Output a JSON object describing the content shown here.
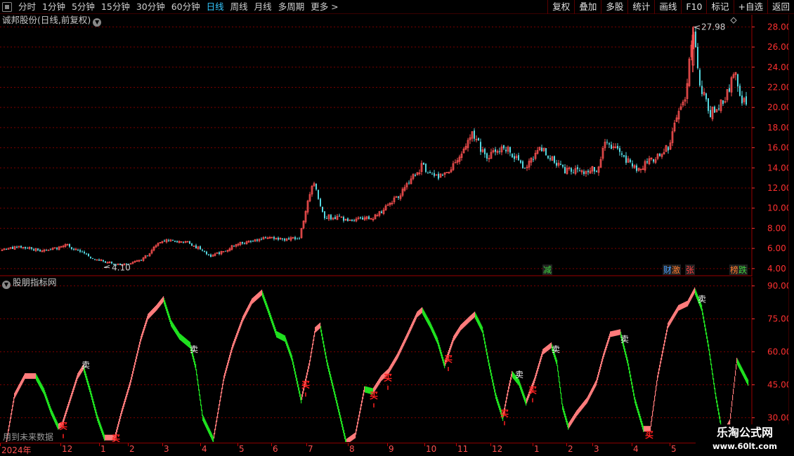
{
  "toolbar": {
    "periods": [
      "分时",
      "1分钟",
      "5分钟",
      "15分钟",
      "30分钟",
      "60分钟",
      "日线",
      "周线",
      "月线",
      "多周期",
      "更多"
    ],
    "active_period": "日线",
    "more_arrow": ">",
    "tools": [
      "复权",
      "叠加",
      "多股",
      "统计",
      "画线",
      "F10",
      "标记",
      "+自选",
      "返回"
    ]
  },
  "main_chart": {
    "title": "诚邦股份(日线,前复权)",
    "price_ticks": [
      "28.00",
      "26.00",
      "24.00",
      "22.00",
      "20.00",
      "18.00",
      "16.00",
      "14.00",
      "12.00",
      "10.00",
      "8.00",
      "6.00",
      "4.00"
    ],
    "high_label": "27.98",
    "low_label": "4.10",
    "markers": [
      {
        "text": "减",
        "color": "#3fd23f"
      },
      {
        "text": "财",
        "color": "#4aa0ff"
      },
      {
        "text": "激",
        "color": "#ff7b2e"
      },
      {
        "text": "张",
        "color": "#ff4040"
      },
      {
        "text": "榜",
        "color": "#ff7b2e"
      },
      {
        "text": "跌",
        "color": "#3fd23f"
      }
    ],
    "colors": {
      "up": "#ff5252",
      "down": "#54d8e0",
      "grid": "#7a0000"
    }
  },
  "sub_chart": {
    "title": "股朋指标网",
    "value_ticks": [
      "90.00",
      "75.00",
      "60.00",
      "45.00",
      "30.00"
    ],
    "sell_label": "卖",
    "buy_label": "买",
    "future_text": "用到未来数据",
    "colors": {
      "rising": "#ff7b7b",
      "falling": "#1fe01f"
    }
  },
  "date_axis": {
    "labels": [
      "2024年",
      "12",
      "1",
      "2",
      "3",
      "4",
      "5",
      "6",
      "7",
      "8",
      "9",
      "10",
      "11",
      "12",
      "1",
      "2",
      "3",
      "4",
      "5"
    ]
  },
  "watermark": {
    "title": "乐淘公式网",
    "url": "www.60lt.com"
  },
  "chart_data": [
    {
      "type": "candlestick",
      "title": "诚邦股份(日线,前复权)",
      "ylim": [
        3.5,
        29
      ],
      "y_ticks": [
        4,
        6,
        8,
        10,
        12,
        14,
        16,
        18,
        20,
        22,
        24,
        26,
        28
      ],
      "anchors_close": [
        [
          0,
          5.8
        ],
        [
          30,
          6.2
        ],
        [
          60,
          5.7
        ],
        [
          95,
          6.3
        ],
        [
          130,
          5.0
        ],
        [
          170,
          4.3
        ],
        [
          200,
          4.8
        ],
        [
          230,
          6.8
        ],
        [
          265,
          6.7
        ],
        [
          300,
          5.2
        ],
        [
          340,
          6.5
        ],
        [
          380,
          7.0
        ],
        [
          425,
          6.9
        ],
        [
          438,
          11.0
        ],
        [
          446,
          12.5
        ],
        [
          460,
          9.2
        ],
        [
          500,
          8.8
        ],
        [
          530,
          9.0
        ],
        [
          545,
          9.8
        ],
        [
          570,
          11.5
        ],
        [
          600,
          14.2
        ],
        [
          620,
          13.0
        ],
        [
          650,
          14.5
        ],
        [
          672,
          17.5
        ],
        [
          690,
          15.0
        ],
        [
          720,
          16.0
        ],
        [
          745,
          14.0
        ],
        [
          770,
          16.0
        ],
        [
          800,
          13.8
        ],
        [
          830,
          13.5
        ],
        [
          850,
          14.0
        ],
        [
          860,
          16.5
        ],
        [
          880,
          15.5
        ],
        [
          905,
          13.8
        ],
        [
          930,
          15.0
        ],
        [
          950,
          16.0
        ],
        [
          965,
          19.5
        ],
        [
          975,
          21.0
        ],
        [
          985,
          27.8
        ],
        [
          995,
          22.0
        ],
        [
          1010,
          19.5
        ],
        [
          1025,
          20.5
        ],
        [
          1035,
          21.5
        ],
        [
          1045,
          24.0
        ],
        [
          1055,
          20.5
        ],
        [
          1062,
          20.5
        ]
      ],
      "high_point": {
        "x": 986,
        "value": 27.98
      },
      "low_point": {
        "x": 148,
        "value": 4.1
      }
    },
    {
      "type": "line",
      "title": "股朋指标网",
      "ylim": [
        19,
        94
      ],
      "y_ticks": [
        30,
        45,
        60,
        75,
        90
      ],
      "anchors": [
        [
          8,
          18
        ],
        [
          20,
          40
        ],
        [
          35,
          49
        ],
        [
          50,
          49
        ],
        [
          62,
          42
        ],
        [
          72,
          33
        ],
        [
          82,
          26
        ],
        [
          88,
          27
        ],
        [
          98,
          37
        ],
        [
          110,
          49
        ],
        [
          118,
          53
        ],
        [
          128,
          42
        ],
        [
          138,
          30
        ],
        [
          148,
          21
        ],
        [
          163,
          21
        ],
        [
          172,
          32
        ],
        [
          185,
          46
        ],
        [
          200,
          66
        ],
        [
          210,
          76
        ],
        [
          222,
          80
        ],
        [
          232,
          84
        ],
        [
          243,
          73
        ],
        [
          255,
          67
        ],
        [
          270,
          63
        ],
        [
          278,
          53
        ],
        [
          288,
          30
        ],
        [
          303,
          20
        ],
        [
          318,
          48
        ],
        [
          330,
          62
        ],
        [
          345,
          75
        ],
        [
          358,
          83
        ],
        [
          372,
          87
        ],
        [
          380,
          80
        ],
        [
          393,
          68
        ],
        [
          405,
          66
        ],
        [
          415,
          57
        ],
        [
          428,
          38
        ],
        [
          440,
          55
        ],
        [
          448,
          70
        ],
        [
          455,
          72
        ],
        [
          465,
          55
        ],
        [
          478,
          38
        ],
        [
          492,
          19
        ],
        [
          505,
          22
        ],
        [
          518,
          43
        ],
        [
          530,
          42
        ],
        [
          542,
          48
        ],
        [
          552,
          51
        ],
        [
          565,
          58
        ],
        [
          580,
          68
        ],
        [
          593,
          77
        ],
        [
          600,
          79
        ],
        [
          612,
          72
        ],
        [
          622,
          65
        ],
        [
          632,
          54
        ],
        [
          645,
          66
        ],
        [
          655,
          71
        ],
        [
          668,
          75
        ],
        [
          675,
          77
        ],
        [
          686,
          70
        ],
        [
          695,
          55
        ],
        [
          705,
          40
        ],
        [
          715,
          30
        ],
        [
          723,
          43
        ],
        [
          728,
          50
        ],
        [
          738,
          46
        ],
        [
          748,
          37
        ],
        [
          760,
          47
        ],
        [
          772,
          60
        ],
        [
          784,
          63
        ],
        [
          792,
          55
        ],
        [
          800,
          35
        ],
        [
          808,
          26
        ],
        [
          820,
          32
        ],
        [
          835,
          38
        ],
        [
          848,
          46
        ],
        [
          858,
          58
        ],
        [
          868,
          68
        ],
        [
          882,
          69
        ],
        [
          893,
          55
        ],
        [
          903,
          38
        ],
        [
          915,
          25
        ],
        [
          925,
          25
        ],
        [
          935,
          48
        ],
        [
          950,
          72
        ],
        [
          965,
          80
        ],
        [
          978,
          82
        ],
        [
          988,
          88
        ],
        [
          998,
          80
        ],
        [
          1008,
          62
        ],
        [
          1018,
          40
        ],
        [
          1028,
          22
        ],
        [
          1038,
          28
        ],
        [
          1048,
          56
        ],
        [
          1056,
          51
        ],
        [
          1064,
          46
        ]
      ],
      "sell_signals_x": [
        120,
        274,
        737,
        789,
        887,
        997
      ],
      "buy_signals_x": [
        90,
        165,
        435,
        532,
        552,
        638,
        718,
        758,
        924,
        1034
      ]
    }
  ]
}
